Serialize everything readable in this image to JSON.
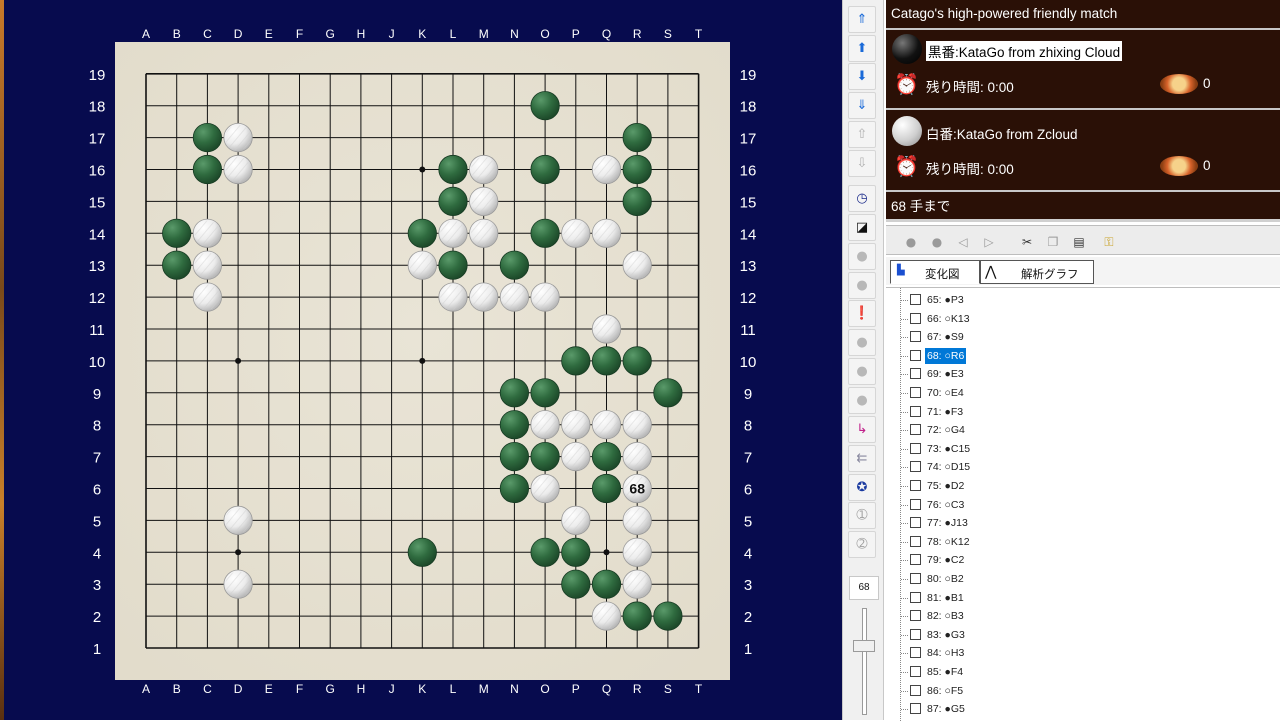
{
  "board": {
    "col_letters": [
      "A",
      "B",
      "C",
      "D",
      "E",
      "F",
      "G",
      "H",
      "J",
      "K",
      "L",
      "M",
      "N",
      "O",
      "P",
      "Q",
      "R",
      "S",
      "T"
    ],
    "row_numbers": [
      "1",
      "2",
      "3",
      "4",
      "5",
      "6",
      "7",
      "8",
      "9",
      "10",
      "11",
      "12",
      "13",
      "14",
      "15",
      "16",
      "17",
      "18",
      "19"
    ],
    "star_points": [
      "D4",
      "K4",
      "Q4",
      "D10",
      "K10",
      "Q10",
      "D16",
      "K16",
      "Q16"
    ],
    "black_stones": [
      "O18",
      "C17",
      "R17",
      "C16",
      "L16",
      "O16",
      "R16",
      "L15",
      "R15",
      "B14",
      "K14",
      "O14",
      "B13",
      "L13",
      "N13",
      "P10",
      "Q10",
      "R10",
      "N9",
      "O9",
      "S9",
      "N8",
      "N7",
      "O7",
      "Q7",
      "N6",
      "Q6",
      "K4",
      "O4",
      "P4",
      "P3",
      "Q3",
      "R2",
      "S2"
    ],
    "white_stones": [
      "D17",
      "D16",
      "M16",
      "Q16",
      "M15",
      "C14",
      "L14",
      "M14",
      "P14",
      "Q14",
      "C13",
      "K13",
      "R13",
      "C12",
      "L12",
      "M12",
      "N12",
      "O12",
      "Q11",
      "O8",
      "P8",
      "Q8",
      "R8",
      "P7",
      "R7",
      "O6",
      "R6",
      "D5",
      "P5",
      "R5",
      "R4",
      "D3",
      "R3",
      "Q2"
    ],
    "last_move": {
      "point": "R6",
      "number": "68"
    },
    "colors": {
      "background": "#070b4e",
      "board": "#e2dccb",
      "black_stone": "#2f6b3f",
      "white_stone": "#ececec"
    }
  },
  "toolbar": {
    "buttons": [
      {
        "name": "first-move-button",
        "icon": "double-up-arrow-icon"
      },
      {
        "name": "prev-move-button",
        "icon": "up-arrow-icon"
      },
      {
        "name": "next-move-button",
        "icon": "down-arrow-icon"
      },
      {
        "name": "last-move-button",
        "icon": "double-down-arrow-icon"
      },
      {
        "name": "page-up-button",
        "icon": "page-up-icon"
      },
      {
        "name": "page-down-button",
        "icon": "page-down-icon"
      },
      {
        "name": "clock-button",
        "icon": "clock-icon"
      },
      {
        "name": "board-color-button",
        "icon": "contrast-icon"
      },
      {
        "name": "gray-button-1",
        "icon": "gray-circle-icon"
      },
      {
        "name": "gray-button-2",
        "icon": "gray-circle-icon"
      },
      {
        "name": "alert-button",
        "icon": "exclamation-icon"
      },
      {
        "name": "gray-button-3",
        "icon": "gray-circle-icon"
      },
      {
        "name": "gray-button-4",
        "icon": "gray-circle-icon"
      },
      {
        "name": "gray-button-5",
        "icon": "gray-circle-icon"
      },
      {
        "name": "branch-button",
        "icon": "branch-arrow-icon"
      },
      {
        "name": "back-button",
        "icon": "back-arrow-icon"
      },
      {
        "name": "person-button",
        "icon": "person-icon"
      },
      {
        "name": "step-one-button",
        "icon": "number-one-icon"
      },
      {
        "name": "step-two-button",
        "icon": "number-two-icon"
      }
    ],
    "move_number": "68",
    "slider_level": 0.3
  },
  "game": {
    "title": "Catago's high-powered friendly match",
    "black_label": "黒番:KataGo from zhixing Cloud",
    "white_label": "白番:KataGo from Zcloud",
    "black_time": "残り時間: 0:00",
    "white_time": "残り時間: 0:00",
    "black_captures": "0",
    "white_captures": "0",
    "status": "68 手まで"
  },
  "tabs": {
    "variation": "変化図",
    "analysis": "解析グラフ"
  },
  "moves": [
    {
      "label": "65: ●P3"
    },
    {
      "label": "66: ○K13"
    },
    {
      "label": "67: ●S9"
    },
    {
      "label": "68: ○R6",
      "selected": true
    },
    {
      "label": "69: ●E3"
    },
    {
      "label": "70: ○E4"
    },
    {
      "label": "71: ●F3"
    },
    {
      "label": "72: ○G4"
    },
    {
      "label": "73: ●C15"
    },
    {
      "label": "74: ○D15"
    },
    {
      "label": "75: ●D2"
    },
    {
      "label": "76: ○C3"
    },
    {
      "label": "77: ●J13"
    },
    {
      "label": "78: ○K12"
    },
    {
      "label": "79: ●C2"
    },
    {
      "label": "80: ○B2"
    },
    {
      "label": "81: ●B1"
    },
    {
      "label": "82: ○B3"
    },
    {
      "label": "83: ●G3"
    },
    {
      "label": "84: ○H3"
    },
    {
      "label": "85: ●F4"
    },
    {
      "label": "86: ○F5"
    },
    {
      "label": "87: ●G5"
    }
  ]
}
